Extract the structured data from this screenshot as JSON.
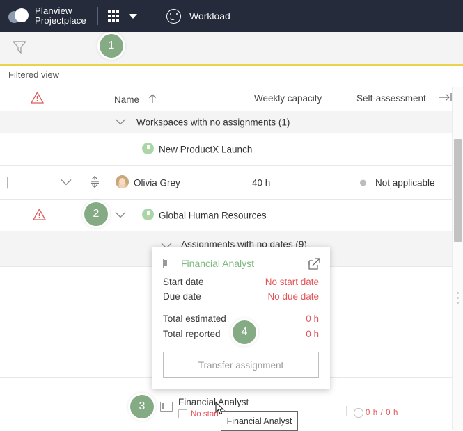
{
  "topbar": {
    "brand_line1": "Planview",
    "brand_line2": "Projectplace",
    "app_title": "Workload",
    "icons": {
      "apps_grid": "grid-menu-icon",
      "caret": "chevron-down-icon",
      "help": "smiley-icon"
    }
  },
  "toolbar": {
    "filter_icon": "filter-funnel-icon"
  },
  "subbar": {
    "filtered_view_label": "Filtered view"
  },
  "table": {
    "headers": {
      "warning": "warning-triangle-icon",
      "name": "Name",
      "sort_direction": "ascending",
      "weekly_capacity": "Weekly capacity",
      "self_assessment": "Self-assessment",
      "expand": "arrow-right-icon"
    },
    "rows": [
      {
        "type": "group",
        "label": "Workspaces with no assignments (1)"
      },
      {
        "type": "workspace",
        "label": "New ProductX Launch"
      },
      {
        "type": "member",
        "name": "Olivia Grey",
        "weekly_capacity": "40 h",
        "self_assessment": "Not applicable"
      },
      {
        "type": "workspace",
        "label": "Global Human Resources",
        "warning": true
      },
      {
        "type": "group",
        "label": "Assignments with no dates (9)"
      }
    ]
  },
  "popup": {
    "title": "Financial Analyst",
    "open_icon": "external-link-icon",
    "fields": [
      {
        "label": "Start date",
        "value": "No start date"
      },
      {
        "label": "Due date",
        "value": "No due date"
      },
      {
        "label": "Total estimated",
        "value": "0 h"
      },
      {
        "label": "Total reported",
        "value": "0 h"
      }
    ],
    "transfer_button": "Transfer assignment"
  },
  "assignment_row": {
    "name": "Financial Analyst",
    "no_start_date": "No start date",
    "hours": "0 h / 0 h"
  },
  "tooltip": {
    "text": "Financial Analyst"
  },
  "badges": [
    {
      "number": "1"
    },
    {
      "number": "2"
    },
    {
      "number": "3"
    },
    {
      "number": "4"
    }
  ],
  "colors": {
    "topbar_bg": "#252b3a",
    "accent_yellow": "#ead34a",
    "badge_green": "#84ab84",
    "link_green": "#7dba7d",
    "alert_red": "#e2555a"
  }
}
